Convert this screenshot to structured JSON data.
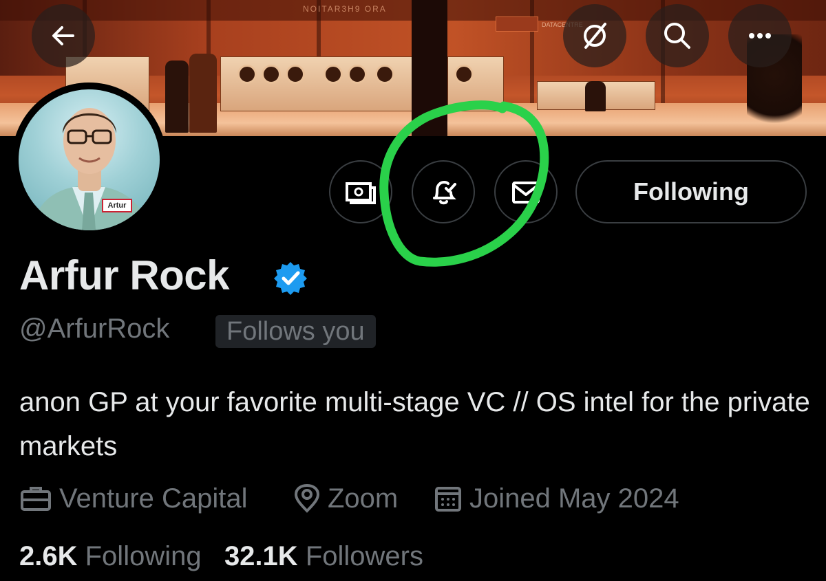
{
  "banner": {
    "sign_text": "NOITAR3H9 ORA",
    "brand_text": "DATACENTRE"
  },
  "avatar": {
    "badge_text": "Artur"
  },
  "actions": {
    "follow_label": "Following"
  },
  "profile": {
    "display_name": "Arfur Rock",
    "handle": "@ArfurRock",
    "follows_you": "Follows you",
    "bio": "anon GP at your favorite multi-stage VC // OS intel for the private markets"
  },
  "meta": {
    "category": "Venture Capital",
    "location": "Zoom",
    "joined": "Joined May 2024"
  },
  "stats": {
    "following_count": "2.6K",
    "following_label": "Following",
    "followers_count": "32.1K",
    "followers_label": "Followers"
  },
  "colors": {
    "verified": "#1d9bf0",
    "annotation": "#2ad14a"
  }
}
